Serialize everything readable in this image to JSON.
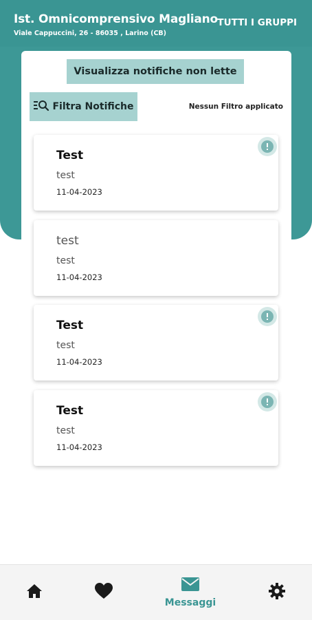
{
  "header": {
    "school_name": "Ist. Omnicomprensivo Magliano",
    "address": "Viale Cappuccini, 26 - 86035 , Larino (CB)",
    "groups_button": "TUTTI I GRUPPI"
  },
  "toolbar": {
    "unread_button": "Visualizza notifiche non lette",
    "filter_button": "Filtra Notifiche",
    "filter_status": "Nessun Filtro applicato"
  },
  "notifications": [
    {
      "title": "Test",
      "body": "test",
      "date": "11-04-2023",
      "unread": true
    },
    {
      "title": "test",
      "body": "test",
      "date": "11-04-2023",
      "unread": false
    },
    {
      "title": "Test",
      "body": "test",
      "date": "11-04-2023",
      "unread": true
    },
    {
      "title": "Test",
      "body": "test",
      "date": "11-04-2023",
      "unread": true
    }
  ],
  "bottom_nav": {
    "items": [
      {
        "icon": "home-icon",
        "label": "",
        "active": false
      },
      {
        "icon": "heart-icon",
        "label": "",
        "active": false
      },
      {
        "icon": "mail-icon",
        "label": "Messaggi",
        "active": true
      },
      {
        "icon": "gear-icon",
        "label": "",
        "active": false
      }
    ]
  },
  "colors": {
    "primary": "#3a9593",
    "button_bg": "#a6d2d0",
    "alert_icon": "#7bb5b3"
  }
}
